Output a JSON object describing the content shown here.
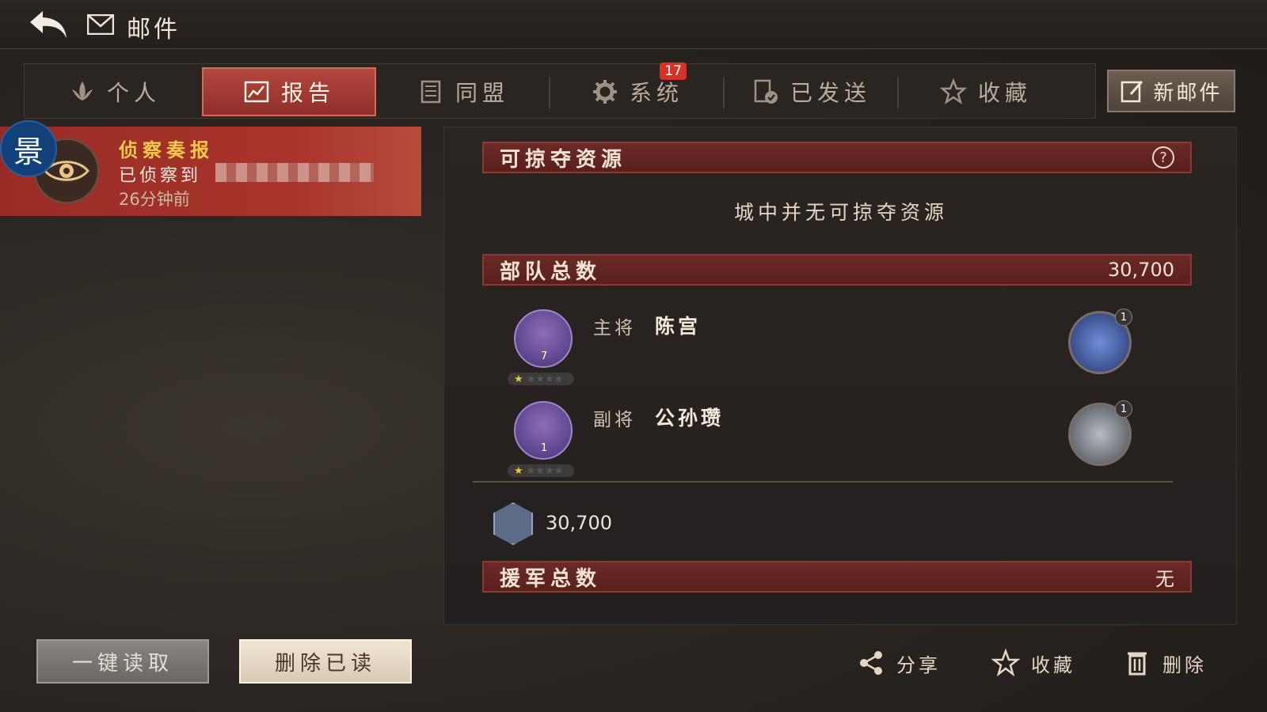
{
  "header": {
    "title": "邮件",
    "back_icon": "back-arrow-icon",
    "mail_icon": "envelope-icon"
  },
  "tabs": [
    {
      "label": "个人",
      "icon": "lotus-icon",
      "active": false
    },
    {
      "label": "报告",
      "icon": "report-icon",
      "active": true
    },
    {
      "label": "同盟",
      "icon": "banner-icon",
      "active": false
    },
    {
      "label": "系统",
      "icon": "gear-icon",
      "active": false,
      "badge": "17"
    },
    {
      "label": "已发送",
      "icon": "sent-doc-icon",
      "active": false
    },
    {
      "label": "收藏",
      "icon": "star-icon",
      "active": false
    }
  ],
  "new_mail": {
    "label": "新邮件",
    "icon": "compose-icon"
  },
  "mail_list": [
    {
      "avatar_char": "景",
      "title": "侦察奏报",
      "desc": "已侦察到",
      "time": "26分钟前",
      "icon": "eye-icon"
    }
  ],
  "report": {
    "resources": {
      "title": "可掠夺资源",
      "empty_text": "城中并无可掠夺资源",
      "help": "?"
    },
    "troops": {
      "title": "部队总数",
      "total": "30,700"
    },
    "generals": [
      {
        "role": "主将",
        "name": "陈宫",
        "level": "7",
        "stars": 1,
        "skill_count": "1"
      },
      {
        "role": "副将",
        "name": "公孙瓒",
        "level": "1",
        "stars": 1,
        "skill_count": "1"
      }
    ],
    "soldier_count": "30,700",
    "reinforce": {
      "title": "援军总数",
      "value": "无"
    }
  },
  "buttons": {
    "read_all": "一键读取",
    "delete_read": "删除已读"
  },
  "actions": {
    "share": "分享",
    "favorite": "收藏",
    "delete": "删除"
  },
  "colors": {
    "accent_red": "#a8352c",
    "gold": "#f3c94a",
    "badge": "#d7322a"
  }
}
